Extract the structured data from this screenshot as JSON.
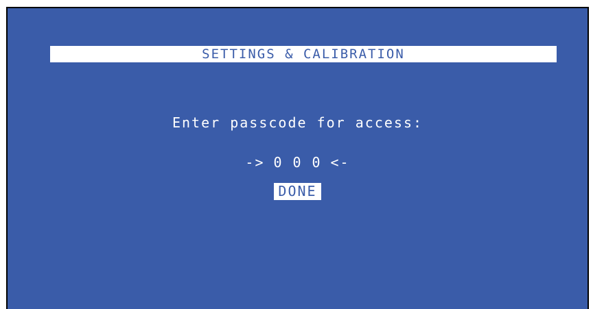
{
  "header": {
    "title": "SETTINGS & CALIBRATION"
  },
  "prompt": {
    "text": "Enter passcode for access:"
  },
  "passcode": {
    "left_arrow": "->",
    "right_arrow": "<-",
    "digits": [
      "0",
      "0",
      "0"
    ]
  },
  "actions": {
    "done_label": "DONE"
  },
  "colors": {
    "background": "#3a5ca9",
    "foreground": "#ffffff"
  }
}
